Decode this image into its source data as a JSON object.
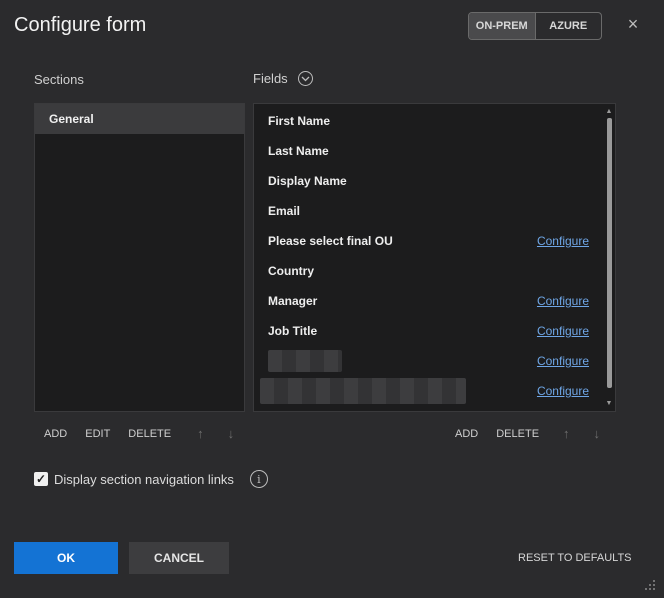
{
  "header": {
    "title": "Configure form",
    "toggle": [
      {
        "label": "ON-PREM",
        "active": true
      },
      {
        "label": "AZURE",
        "active": false
      }
    ],
    "close_icon": "×"
  },
  "sections": {
    "label": "Sections",
    "items": [
      "General"
    ],
    "toolbar": {
      "add": "ADD",
      "edit": "EDIT",
      "delete": "DELETE",
      "up": "↑",
      "down": "↓"
    }
  },
  "fields": {
    "label": "Fields",
    "items": [
      {
        "name": "First Name",
        "action": ""
      },
      {
        "name": "Last Name",
        "action": ""
      },
      {
        "name": "Display Name",
        "action": ""
      },
      {
        "name": "Email",
        "action": ""
      },
      {
        "name": "Please select final OU",
        "action": "Configure"
      },
      {
        "name": "Country",
        "action": ""
      },
      {
        "name": "Manager",
        "action": "Configure"
      },
      {
        "name": "Job Title",
        "action": "Configure"
      },
      {
        "name": "",
        "action": "Configure"
      },
      {
        "name": "",
        "action": "Configure"
      }
    ],
    "toolbar": {
      "add": "ADD",
      "delete": "DELETE",
      "up": "↑",
      "down": "↓"
    }
  },
  "options": {
    "display_section_nav_links": {
      "label": "Display section navigation links",
      "checked": true
    }
  },
  "footer": {
    "ok": "OK",
    "cancel": "CANCEL",
    "reset": "RESET TO DEFAULTS"
  },
  "colors": {
    "accent": "#1473d4",
    "link": "#6fa6e6",
    "background": "#2b2b2d"
  }
}
